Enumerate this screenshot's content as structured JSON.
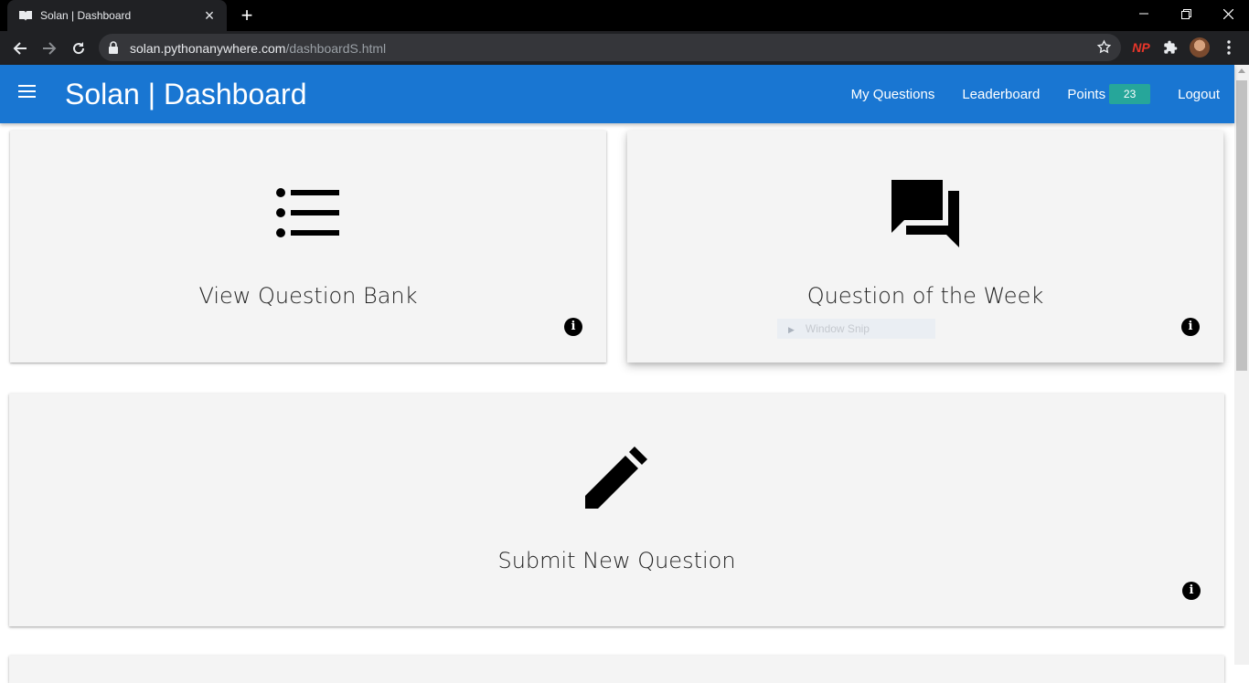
{
  "browser": {
    "tab_title": "Solan | Dashboard",
    "url_host": "solan.pythonanywhere.com",
    "url_path": "/dashboardS.html",
    "extension_label": "NP"
  },
  "appbar": {
    "title": "Solan | Dashboard",
    "color": "#1976d2",
    "nav": {
      "my_questions": "My Questions",
      "leaderboard": "Leaderboard",
      "points_label": "Points",
      "points_value": "23",
      "logout": "Logout"
    }
  },
  "cards": {
    "question_bank": {
      "label": "View Question Bank",
      "icon": "list-icon"
    },
    "question_of_week": {
      "label": "Question of the Week",
      "icon": "forum-icon"
    },
    "submit_question": {
      "label": "Submit New Question",
      "icon": "pencil-icon"
    }
  },
  "overlay": {
    "snip_label": "Window Snip"
  },
  "colors": {
    "badge": "#26a69a",
    "card_bg": "#f4f4f4"
  }
}
